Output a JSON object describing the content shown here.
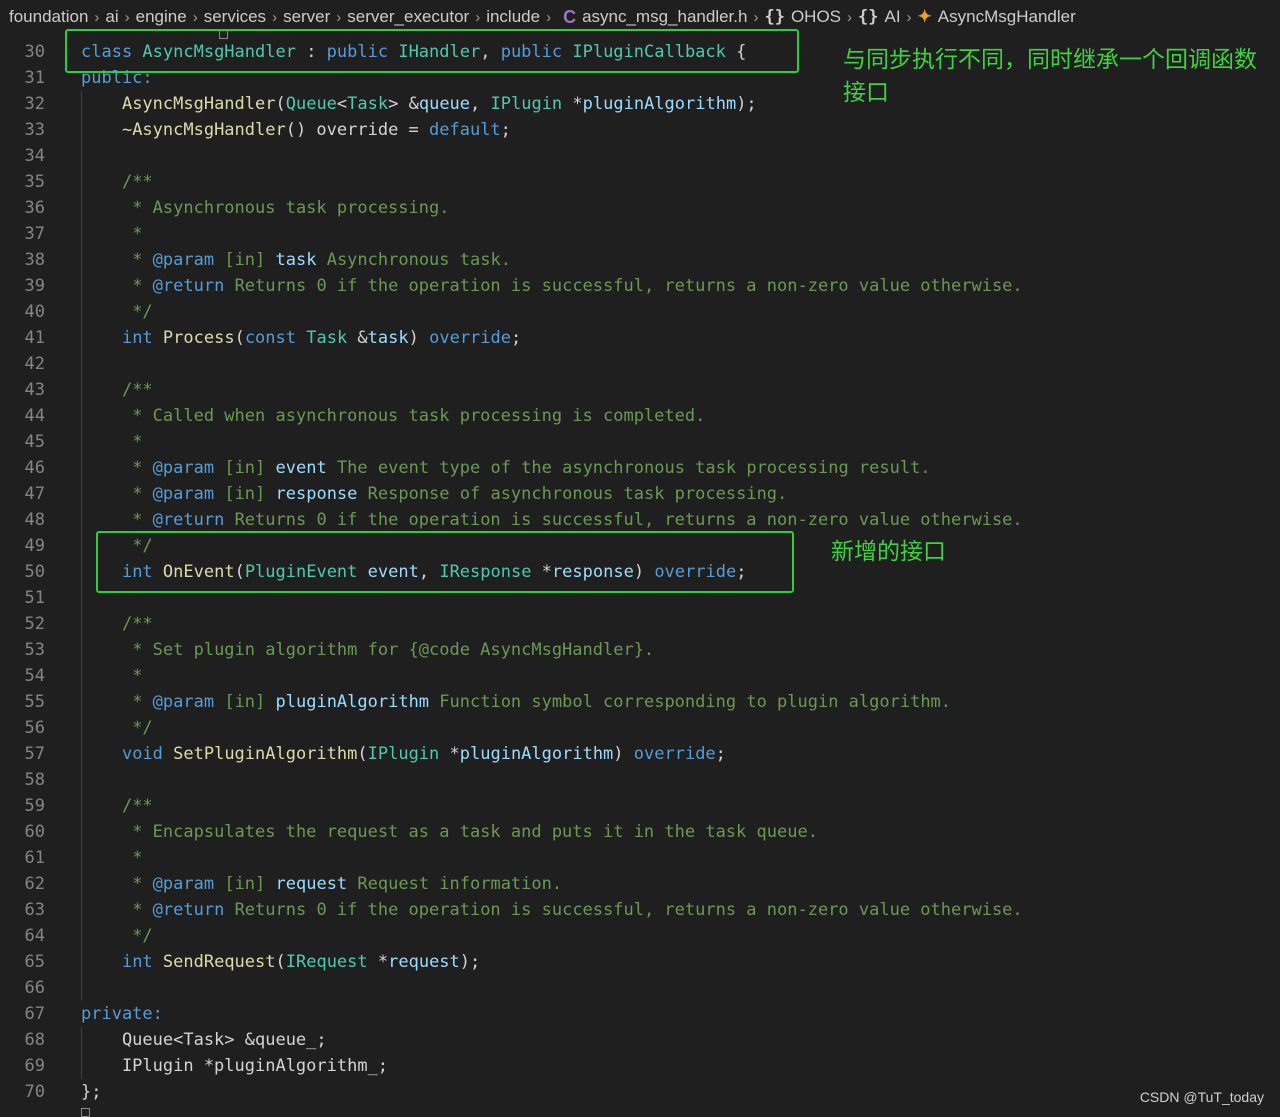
{
  "breadcrumb": {
    "items": [
      "foundation",
      "ai",
      "engine",
      "services",
      "server",
      "server_executor",
      "include"
    ],
    "file_icon": "C",
    "file_name": "async_msg_handler.h",
    "namespace_icon": "{}",
    "namespaces": [
      "OHOS",
      "AI"
    ],
    "class_icon": "class-icon",
    "class_name": "AsyncMsgHandler"
  },
  "editor": {
    "line_numbers": [
      "30",
      "31",
      "32",
      "33",
      "34",
      "35",
      "36",
      "37",
      "38",
      "39",
      "40",
      "41",
      "42",
      "43",
      "44",
      "45",
      "46",
      "47",
      "48",
      "49",
      "50",
      "51",
      "52",
      "53",
      "54",
      "55",
      "56",
      "57",
      "58",
      "59",
      "60",
      "61",
      "62",
      "63",
      "64",
      "65",
      "66",
      "67",
      "68",
      "69",
      "70"
    ],
    "lines": [
      [
        [
          "kw",
          "class "
        ],
        [
          "ty",
          "AsyncMsgHandler"
        ],
        [
          "pl",
          " : "
        ],
        [
          "kw",
          "public "
        ],
        [
          "ty",
          "IHandler"
        ],
        [
          "pl",
          ", "
        ],
        [
          "kw",
          "public "
        ],
        [
          "ty",
          "IPluginCallback"
        ],
        [
          "pl",
          " {"
        ]
      ],
      [
        [
          "kw",
          "public:"
        ]
      ],
      [
        [
          "pl",
          "    "
        ],
        [
          "fn",
          "AsyncMsgHandler"
        ],
        [
          "pl",
          "("
        ],
        [
          "ty",
          "Queue"
        ],
        [
          "pl",
          "<"
        ],
        [
          "ty",
          "Task"
        ],
        [
          "pl",
          "> &"
        ],
        [
          "pa",
          "queue"
        ],
        [
          "pl",
          ", "
        ],
        [
          "ty",
          "IPlugin"
        ],
        [
          "pl",
          " *"
        ],
        [
          "pa",
          "pluginAlgorithm"
        ],
        [
          "pl",
          ");"
        ]
      ],
      [
        [
          "pl",
          "    ~"
        ],
        [
          "fn",
          "AsyncMsgHandler"
        ],
        [
          "pl",
          "() override = "
        ],
        [
          "kw",
          "default"
        ],
        [
          "pl",
          ";"
        ]
      ],
      [],
      [
        [
          "pl",
          "    "
        ],
        [
          "cm",
          "/**"
        ]
      ],
      [
        [
          "pl",
          "    "
        ],
        [
          "cm",
          " * Asynchronous task processing."
        ]
      ],
      [
        [
          "pl",
          "    "
        ],
        [
          "cm",
          " *"
        ]
      ],
      [
        [
          "pl",
          "    "
        ],
        [
          "cm",
          " * "
        ],
        [
          "tg",
          "@param"
        ],
        [
          "cm",
          " [in] "
        ],
        [
          "pa",
          "task"
        ],
        [
          "cm",
          " Asynchronous task."
        ]
      ],
      [
        [
          "pl",
          "    "
        ],
        [
          "cm",
          " * "
        ],
        [
          "tg",
          "@return"
        ],
        [
          "cm",
          " Returns 0 if the operation is successful, returns a non-zero value otherwise."
        ]
      ],
      [
        [
          "pl",
          "    "
        ],
        [
          "cm",
          " */"
        ]
      ],
      [
        [
          "pl",
          "    "
        ],
        [
          "kw",
          "int "
        ],
        [
          "fn",
          "Process"
        ],
        [
          "pl",
          "("
        ],
        [
          "kw",
          "const "
        ],
        [
          "ty",
          "Task"
        ],
        [
          "pl",
          " &"
        ],
        [
          "pa",
          "task"
        ],
        [
          "pl",
          ") "
        ],
        [
          "kw",
          "override"
        ],
        [
          "pl",
          ";"
        ]
      ],
      [],
      [
        [
          "pl",
          "    "
        ],
        [
          "cm",
          "/**"
        ]
      ],
      [
        [
          "pl",
          "    "
        ],
        [
          "cm",
          " * Called when asynchronous task processing is completed."
        ]
      ],
      [
        [
          "pl",
          "    "
        ],
        [
          "cm",
          " *"
        ]
      ],
      [
        [
          "pl",
          "    "
        ],
        [
          "cm",
          " * "
        ],
        [
          "tg",
          "@param"
        ],
        [
          "cm",
          " [in] "
        ],
        [
          "pa",
          "event"
        ],
        [
          "cm",
          " The event type of the asynchronous task processing result."
        ]
      ],
      [
        [
          "pl",
          "    "
        ],
        [
          "cm",
          " * "
        ],
        [
          "tg",
          "@param"
        ],
        [
          "cm",
          " [in] "
        ],
        [
          "pa",
          "response"
        ],
        [
          "cm",
          " Response of asynchronous task processing."
        ]
      ],
      [
        [
          "pl",
          "    "
        ],
        [
          "cm",
          " * "
        ],
        [
          "tg",
          "@return"
        ],
        [
          "cm",
          " Returns 0 if the operation is successful, returns a non-zero value otherwise."
        ]
      ],
      [
        [
          "pl",
          "    "
        ],
        [
          "cm",
          " */"
        ]
      ],
      [
        [
          "pl",
          "    "
        ],
        [
          "kw",
          "int "
        ],
        [
          "fn",
          "OnEvent"
        ],
        [
          "pl",
          "("
        ],
        [
          "ty",
          "PluginEvent"
        ],
        [
          "pl",
          " "
        ],
        [
          "pa",
          "event"
        ],
        [
          "pl",
          ", "
        ],
        [
          "ty",
          "IResponse"
        ],
        [
          "pl",
          " *"
        ],
        [
          "pa",
          "response"
        ],
        [
          "pl",
          ") "
        ],
        [
          "kw",
          "override"
        ],
        [
          "pl",
          ";"
        ]
      ],
      [],
      [
        [
          "pl",
          "    "
        ],
        [
          "cm",
          "/**"
        ]
      ],
      [
        [
          "pl",
          "    "
        ],
        [
          "cm",
          " * Set plugin algorithm for {@code AsyncMsgHandler}."
        ]
      ],
      [
        [
          "pl",
          "    "
        ],
        [
          "cm",
          " *"
        ]
      ],
      [
        [
          "pl",
          "    "
        ],
        [
          "cm",
          " * "
        ],
        [
          "tg",
          "@param"
        ],
        [
          "cm",
          " [in] "
        ],
        [
          "pa",
          "pluginAlgorithm"
        ],
        [
          "cm",
          " Function symbol corresponding to plugin algorithm."
        ]
      ],
      [
        [
          "pl",
          "    "
        ],
        [
          "cm",
          " */"
        ]
      ],
      [
        [
          "pl",
          "    "
        ],
        [
          "kw",
          "void "
        ],
        [
          "fn",
          "SetPluginAlgorithm"
        ],
        [
          "pl",
          "("
        ],
        [
          "ty",
          "IPlugin"
        ],
        [
          "pl",
          " *"
        ],
        [
          "pa",
          "pluginAlgorithm"
        ],
        [
          "pl",
          ") "
        ],
        [
          "kw",
          "override"
        ],
        [
          "pl",
          ";"
        ]
      ],
      [],
      [
        [
          "pl",
          "    "
        ],
        [
          "cm",
          "/**"
        ]
      ],
      [
        [
          "pl",
          "    "
        ],
        [
          "cm",
          " * Encapsulates the request as a task and puts it in the task queue."
        ]
      ],
      [
        [
          "pl",
          "    "
        ],
        [
          "cm",
          " *"
        ]
      ],
      [
        [
          "pl",
          "    "
        ],
        [
          "cm",
          " * "
        ],
        [
          "tg",
          "@param"
        ],
        [
          "cm",
          " [in] "
        ],
        [
          "pa",
          "request"
        ],
        [
          "cm",
          " Request information."
        ]
      ],
      [
        [
          "pl",
          "    "
        ],
        [
          "cm",
          " * "
        ],
        [
          "tg",
          "@return"
        ],
        [
          "cm",
          " Returns 0 if the operation is successful, returns a non-zero value otherwise."
        ]
      ],
      [
        [
          "pl",
          "    "
        ],
        [
          "cm",
          " */"
        ]
      ],
      [
        [
          "pl",
          "    "
        ],
        [
          "kw",
          "int "
        ],
        [
          "fn",
          "SendRequest"
        ],
        [
          "pl",
          "("
        ],
        [
          "ty",
          "IRequest"
        ],
        [
          "pl",
          " *"
        ],
        [
          "pa",
          "request"
        ],
        [
          "pl",
          ");"
        ]
      ],
      [],
      [
        [
          "kw",
          "private:"
        ]
      ],
      [
        [
          "pl",
          "    Queue<Task> &queue_;"
        ]
      ],
      [
        [
          "pl",
          "    IPlugin *pluginAlgorithm_;"
        ]
      ],
      [
        [
          "pl",
          "};"
        ]
      ]
    ]
  },
  "annotations": {
    "class_note_line1": "与同步执行不同，同时继承一个回调函数",
    "class_note_line2": "接口",
    "onevent_note": "新增的接口"
  },
  "colors": {
    "highlight_box": "#2ecc40",
    "annotation_text": "#3fd23f"
  },
  "watermark": "CSDN @TuT_today"
}
